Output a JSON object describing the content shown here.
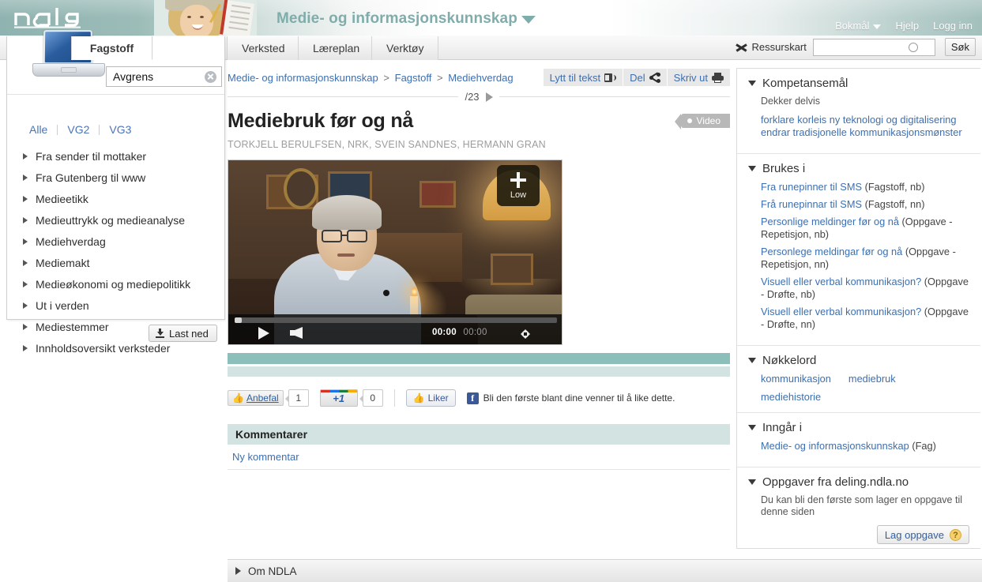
{
  "banner": {
    "logo_alt": "ndla",
    "subject_title": "Medie- og informasjonskunnskap",
    "links": [
      {
        "label": "Bokmål",
        "has_caret": true
      },
      {
        "label": "Hjelp",
        "has_caret": false
      },
      {
        "label": "Logg inn",
        "has_caret": false
      }
    ]
  },
  "tabs": [
    {
      "label": "Fagstoff",
      "active": true
    },
    {
      "label": "Verksted",
      "active": false
    },
    {
      "label": "Læreplan",
      "active": false
    },
    {
      "label": "Verktøy",
      "active": false
    }
  ],
  "resource_map": {
    "label": "Ressurskart"
  },
  "search": {
    "value": "",
    "placeholder": "",
    "button_label": "Søk"
  },
  "left_panel": {
    "filter_input": {
      "value": "Avgrens",
      "placeholder": "Avgrens"
    },
    "levels": [
      "Alle",
      "VG2",
      "VG3"
    ],
    "nav_items": [
      "Fra sender til mottaker",
      "Fra Gutenberg til www",
      "Medieetikk",
      "Medieuttrykk og medieanalyse",
      "Mediehverdag",
      "Mediemakt",
      "Medieøkonomi og mediepolitikk",
      "Ut i verden",
      "Mediestemmer",
      "Innholdsoversikt verksteder"
    ],
    "download_label": "Last ned"
  },
  "content": {
    "breadcrumbs": [
      "Medie- og informasjonskunnskap",
      "Fagstoff",
      "Mediehverdag"
    ],
    "breadcrumb_sep": ">",
    "tools": [
      {
        "label": "Lytt til tekst",
        "icon": "speaker-icon"
      },
      {
        "label": "Del",
        "icon": "share-icon"
      },
      {
        "label": "Skriv ut",
        "icon": "print-icon"
      }
    ],
    "pager": {
      "text": "/23"
    },
    "title": "Mediebruk før og nå",
    "type_tag": "Video",
    "byline": "TORKJELL BERULFSEN, NRK, SVEIN SANDNES, HERMANN GRAN",
    "video": {
      "quality_label": "Low",
      "quality_plus": "+",
      "current_time": "00:00",
      "total_time": "00:00"
    },
    "social": {
      "recommend_label": "Anbefal",
      "recommend_count": "1",
      "gplus_label": "+1",
      "gplus_count": "0",
      "fb_like_label": "Liker",
      "fb_badge": "f",
      "fb_text": "Bli den første blant dine venner til å like dette."
    },
    "comments": {
      "heading": "Kommentarer",
      "new_comment_label": "Ny kommentar"
    }
  },
  "right_sidebar": {
    "sections": [
      {
        "title": "Kompetansemål",
        "subtitle": "Dekker delvis",
        "links": [
          {
            "text": "forklare korleis ny teknologi og digitalisering endrar tradisjonelle kommunikasjonsmønster"
          }
        ]
      },
      {
        "title": "Brukes i",
        "links": [
          {
            "text": "Fra runepinner til SMS",
            "meta": " (Fagstoff, nb)"
          },
          {
            "text": "Frå runepinnar til SMS",
            "meta": " (Fagstoff, nn)"
          },
          {
            "text": "Personlige meldinger før og nå",
            "meta": " (Oppgave - Repetisjon, nb)"
          },
          {
            "text": "Personlege meldingar før og nå",
            "meta": " (Oppgave - Repetisjon, nn)"
          },
          {
            "text": "Visuell eller verbal kommunikasjon?",
            "meta": " (Oppgave - Drøfte, nb)"
          },
          {
            "text": "Visuell eller verbal kommunikasjon?",
            "meta": " (Oppgave - Drøfte, nn)"
          }
        ]
      },
      {
        "title": "Nøkkelord",
        "keywords": [
          "kommunikasjon",
          "mediebruk",
          "mediehistorie"
        ]
      },
      {
        "title": "Inngår i",
        "links": [
          {
            "text": "Medie- og informasjonskunnskap",
            "meta": " (Fag)"
          }
        ]
      },
      {
        "title": "Oppgaver fra deling.ndla.no",
        "note": "Du kan bli den første som lager en oppgave til denne siden",
        "button_label": "Lag oppgave",
        "button_help": "?"
      }
    ]
  },
  "footer": {
    "label": "Om NDLA"
  }
}
